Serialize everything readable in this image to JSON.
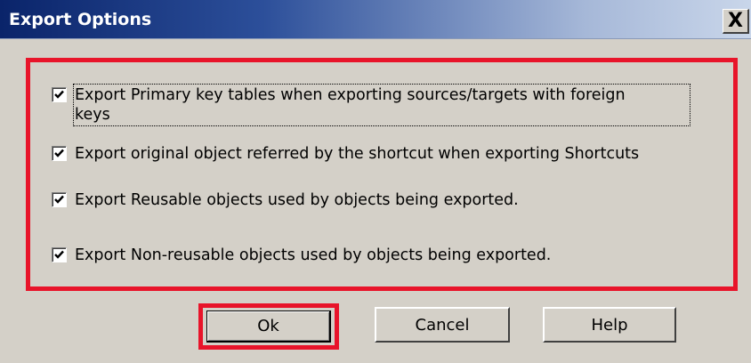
{
  "window": {
    "title": "Export Options",
    "close_label": "X"
  },
  "options": [
    {
      "label_line1": "Export Primary key tables when exporting sources/targets with foreign",
      "label_line2": "keys",
      "checked": true
    },
    {
      "label": "Export original object referred by the shortcut when exporting Shortcuts",
      "checked": true
    },
    {
      "label": "Export Reusable objects used by objects being exported.",
      "checked": true
    },
    {
      "label": "Export Non-reusable objects used by objects being exported.",
      "checked": true
    }
  ],
  "buttons": {
    "ok": "Ok",
    "cancel": "Cancel",
    "help": "Help"
  },
  "colors": {
    "highlight": "#e8142a",
    "titlebar": "#0a246a",
    "dialog": "#d4d0c8"
  }
}
